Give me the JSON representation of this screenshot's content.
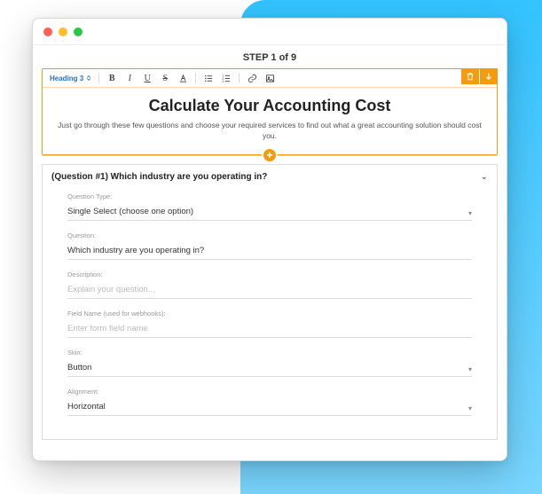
{
  "step_label": "STEP 1 of 9",
  "toolbar": {
    "heading_label": "Heading 3"
  },
  "editor": {
    "title": "Calculate Your Accounting Cost",
    "subtitle": "Just go through these few questions and choose your required services to find out what a great accounting solution should cost you."
  },
  "question": {
    "header": "(Question #1) Which industry are you operating in?",
    "fields": {
      "type_label": "Question Type:",
      "type_value": "Single Select (choose one option)",
      "question_label": "Question:",
      "question_value": "Which industry are you operating in?",
      "description_label": "Description:",
      "description_placeholder": "Explain your question...",
      "fieldname_label": "Field Name (used for webhooks):",
      "fieldname_placeholder": "Enter form field name",
      "skin_label": "Skin:",
      "skin_value": "Button",
      "alignment_label": "Alignment:",
      "alignment_value": "Horizontal"
    }
  }
}
